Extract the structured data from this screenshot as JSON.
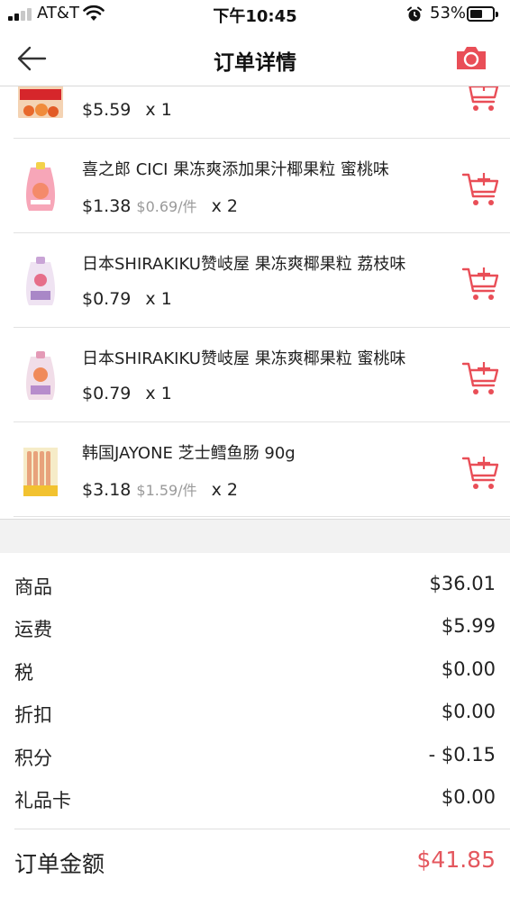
{
  "status_bar": {
    "carrier": "AT&T",
    "time": "下午10:45",
    "battery_percent": "53%",
    "icons": [
      "signal-icon",
      "wifi-icon",
      "alarm-icon",
      "battery-icon"
    ]
  },
  "header": {
    "title": "订单详情",
    "back_icon": "back-arrow-icon",
    "action_icon": "camera-icon",
    "accent_color": "#e94e57"
  },
  "items": [
    {
      "name": "",
      "price": "$5.59",
      "unit_price": "",
      "qty": "x 1"
    },
    {
      "name": "喜之郎 CICI 果冻爽添加果汁椰果粒 蜜桃味",
      "price": "$1.38",
      "unit_price": "$0.69/件",
      "qty": "x 2"
    },
    {
      "name": "日本SHIRAKIKU赞岐屋 果冻爽椰果粒 荔枝味",
      "price": "$0.79",
      "unit_price": "",
      "qty": "x 1"
    },
    {
      "name": "日本SHIRAKIKU赞岐屋 果冻爽椰果粒 蜜桃味",
      "price": "$0.79",
      "unit_price": "",
      "qty": "x 1"
    },
    {
      "name": "韩国JAYONE 芝士鳕鱼肠 90g",
      "price": "$3.18",
      "unit_price": "$1.59/件",
      "qty": "x 2"
    }
  ],
  "summary": [
    {
      "label": "商品",
      "value": "$36.01"
    },
    {
      "label": "运费",
      "value": "$5.99"
    },
    {
      "label": "税",
      "value": "$0.00"
    },
    {
      "label": "折扣",
      "value": "$0.00"
    },
    {
      "label": "积分",
      "value": "- $0.15"
    },
    {
      "label": "礼品卡",
      "value": "$0.00"
    }
  ],
  "total": {
    "label": "订单金额",
    "value": "$41.85",
    "color": "#e4575e"
  }
}
